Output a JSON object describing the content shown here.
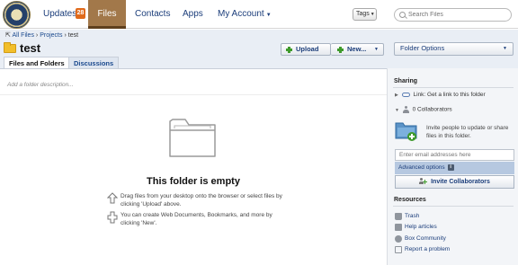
{
  "nav": {
    "updates_label": "Updates",
    "updates_count": "28",
    "files_label": "Files",
    "contacts_label": "Contacts",
    "apps_label": "Apps",
    "account_label": "My Account"
  },
  "search": {
    "tags_label": "Tags",
    "placeholder": "Search Files"
  },
  "breadcrumb": {
    "items": [
      "All Files",
      "Projects",
      "test"
    ],
    "separator": "›"
  },
  "folder": {
    "name": "test",
    "description_placeholder": "Add a folder description..."
  },
  "tabs": [
    {
      "label": "Files and Folders",
      "active": true
    },
    {
      "label": "Discussions",
      "active": false
    }
  ],
  "toolbar": {
    "upload_label": "Upload",
    "new_label": "New...",
    "folder_options_label": "Folder Options"
  },
  "empty_state": {
    "title": "This folder is empty",
    "hint_upload": "Drag files from your desktop onto the browser or select files by clicking 'Upload' above.",
    "hint_create": "You can create Web Documents, Bookmarks, and more by clicking 'New'."
  },
  "sidebar": {
    "sharing_heading": "Sharing",
    "link_label": "Link:",
    "link_text": "Get a link to this folder",
    "collaborators_text": "0 Collaborators",
    "invite_text": "Invite people to update or share files in this folder.",
    "email_placeholder": "Enter email addresses here",
    "advanced_options_label": "Advanced options",
    "invite_button_label": "Invite Collaborators",
    "resources_heading": "Resources",
    "resources": [
      {
        "label": "Trash",
        "icon": "trash-icon"
      },
      {
        "label": "Help articles",
        "icon": "help-icon"
      },
      {
        "label": "Box Community",
        "icon": "community-icon"
      },
      {
        "label": "Report a problem",
        "icon": "report-icon"
      }
    ]
  },
  "colors": {
    "files_tab_active": "#a2784a",
    "nav_text": "#1b3d7a",
    "updates_badge": "#e06a1b",
    "header_band": "#e9eef5",
    "plus_green": "#3e9a2b",
    "folder_yellow": "#f2bf2b"
  }
}
